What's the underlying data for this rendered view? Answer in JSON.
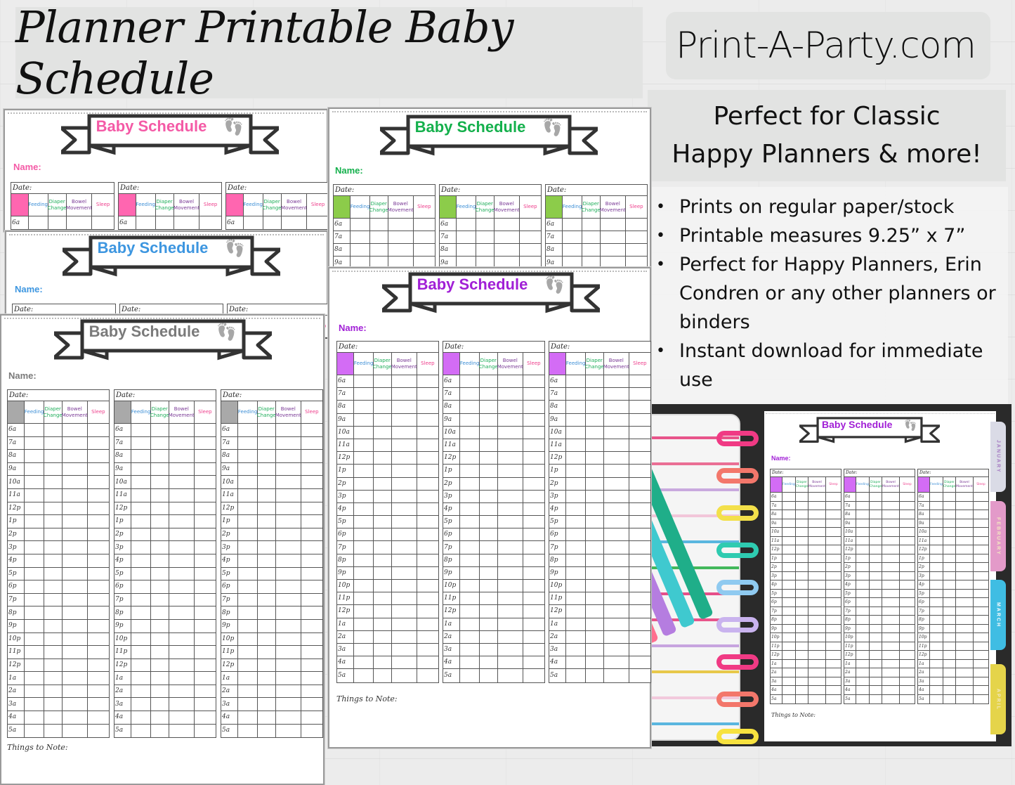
{
  "header": {
    "title": "Planner Printable  Baby Schedule",
    "brand": "Print-A-Party.com",
    "tagline_line1": "Perfect for Classic",
    "tagline_line2": "Happy Planners & more!"
  },
  "features": [
    "Prints on regular paper/stock",
    "Printable measures 9.25” x 7”",
    "Perfect for Happy Planners, Erin Condren or any other planners or binders",
    "Instant download for immediate use"
  ],
  "schedule_template": {
    "title": "Baby Schedule",
    "name_label": "Name:",
    "date_label": "Date:",
    "columns": [
      "",
      "Feeding",
      "Diaper Change",
      "Bowel Movement",
      "Sleep"
    ],
    "column_colors": [
      "",
      "#3d8fd6",
      "#1fae5a",
      "#7a3a96",
      "#ee3f8c"
    ],
    "hours": [
      "6a",
      "7a",
      "8a",
      "9a",
      "10a",
      "11a",
      "12p",
      "1p",
      "2p",
      "3p",
      "4p",
      "5p",
      "6p",
      "7p",
      "8p",
      "9p",
      "10p",
      "11p",
      "12p",
      "1a",
      "2a",
      "3a",
      "4a",
      "5a"
    ],
    "notes_label": "Things to Note:"
  },
  "variants": [
    {
      "name": "pink",
      "accent": "#f45aa6",
      "feet": "#f7a8cf",
      "header_fill": "#ff66b0"
    },
    {
      "name": "blue",
      "accent": "#3d96e0",
      "feet": "#a9cdef",
      "header_fill": "#3d96e0"
    },
    {
      "name": "gray",
      "accent": "#7a7a7a",
      "feet": "#b9b9b9",
      "header_fill": "#a9a9a9"
    },
    {
      "name": "green",
      "accent": "#14b04c",
      "feet": "#b9e6cc",
      "header_fill": "#8ccc4a"
    },
    {
      "name": "purple",
      "accent": "#a11fd6",
      "feet": "#dfb9f2",
      "header_fill": "#d36cf5"
    }
  ],
  "planner_tabs": [
    "JANUARY",
    "FEBRUARY",
    "MARCH",
    "APRIL"
  ],
  "planner_tab_colors": [
    "#dadbe6",
    "#e39ac9",
    "#3fbde3",
    "#e5d44a"
  ]
}
